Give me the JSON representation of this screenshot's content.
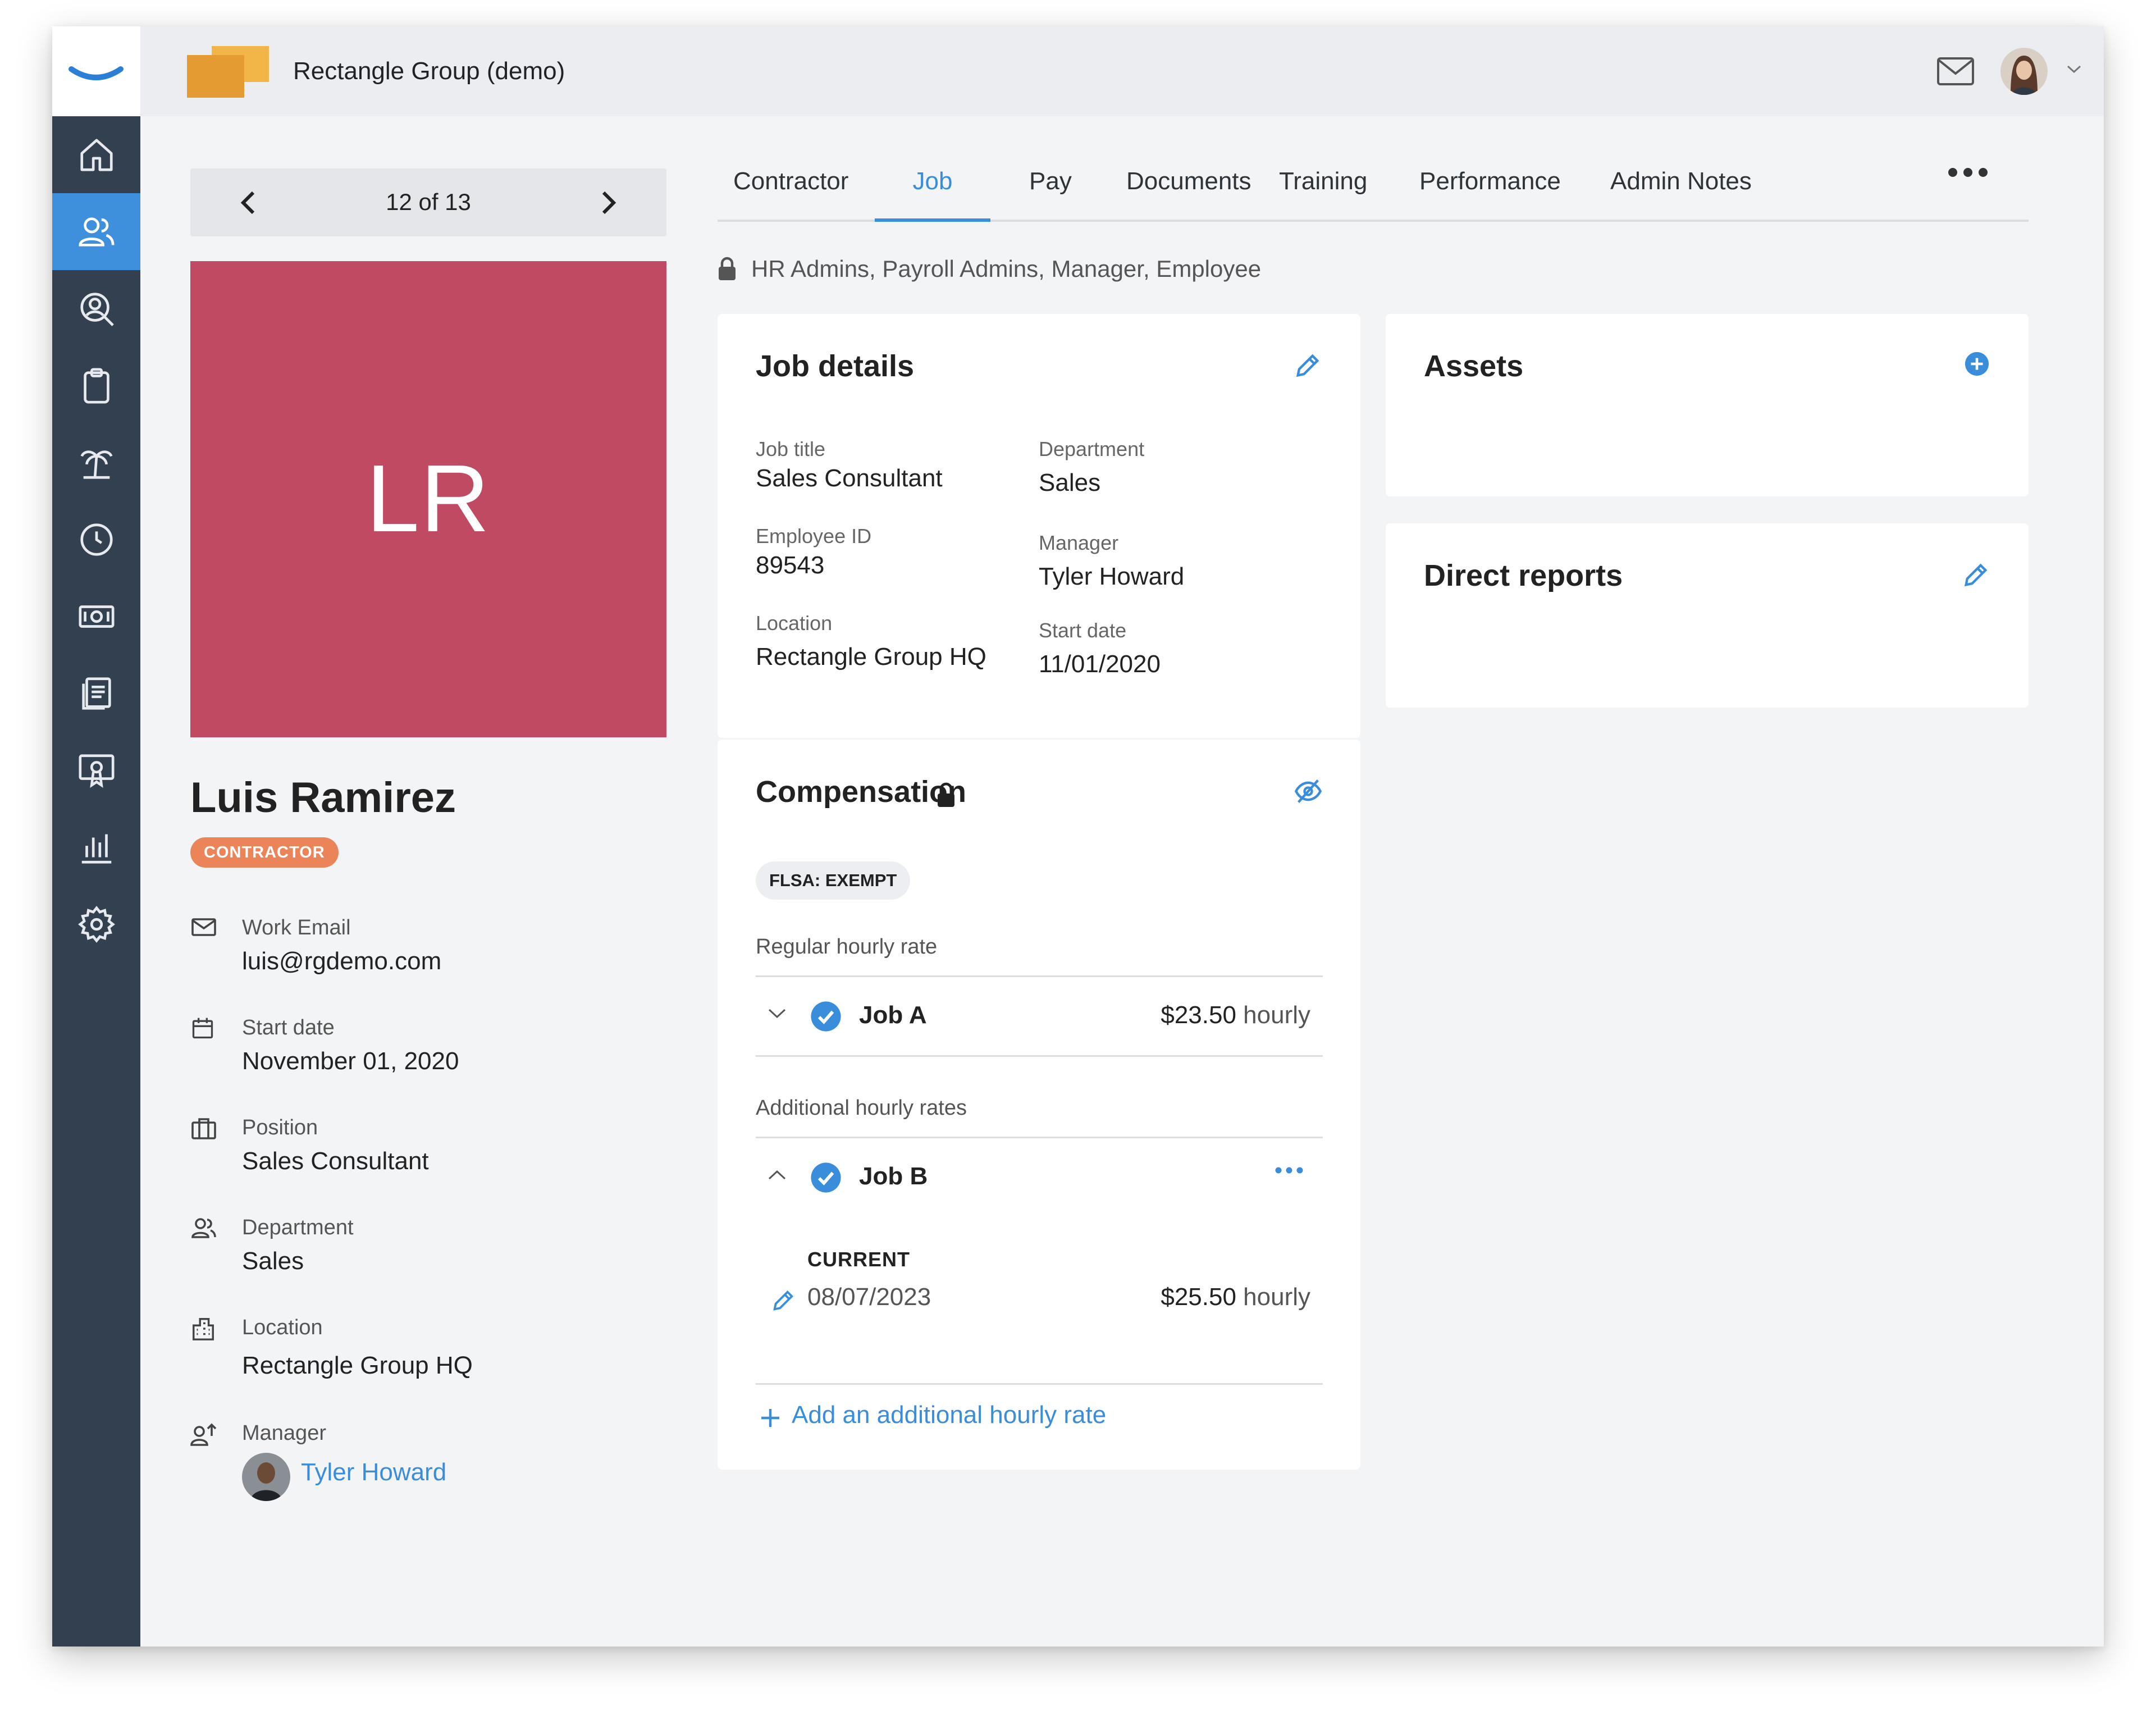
{
  "app": {
    "org_name": "Rectangle Group (demo)"
  },
  "rail": {
    "items": [
      {
        "icon": "home-icon"
      },
      {
        "icon": "people-icon",
        "active": true
      },
      {
        "icon": "user-search-icon"
      },
      {
        "icon": "clipboard-icon"
      },
      {
        "icon": "palm-tree-icon"
      },
      {
        "icon": "clock-icon"
      },
      {
        "icon": "money-icon"
      },
      {
        "icon": "documents-icon"
      },
      {
        "icon": "certificate-icon"
      },
      {
        "icon": "bar-chart-icon"
      },
      {
        "icon": "gear-icon"
      }
    ]
  },
  "pager": {
    "label": "12 of 13"
  },
  "profile": {
    "initials": "LR",
    "name": "Luis Ramirez",
    "badge": "CONTRACTOR",
    "fields": [
      {
        "icon": "mail-icon",
        "label": "Work Email",
        "value": "luis@rgdemo.com"
      },
      {
        "icon": "calendar-icon",
        "label": "Start date",
        "value": "November 01, 2020"
      },
      {
        "icon": "briefcase-icon",
        "label": "Position",
        "value": "Sales Consultant"
      },
      {
        "icon": "people-icon",
        "label": "Department",
        "value": "Sales"
      },
      {
        "icon": "building-icon",
        "label": "Location",
        "value": "Rectangle Group HQ"
      },
      {
        "icon": "manager-icon",
        "label": "Manager",
        "value": "Tyler Howard"
      }
    ]
  },
  "tabs": [
    "Contractor",
    "Job",
    "Pay",
    "Documents",
    "Training",
    "Performance",
    "Admin Notes"
  ],
  "active_tab": "Job",
  "access": {
    "text": "HR Admins, Payroll Admins, Manager, Employee"
  },
  "job_details": {
    "title": "Job details",
    "left": [
      {
        "label": "Job title",
        "value": "Sales Consultant"
      },
      {
        "label": "Employee ID",
        "value": "89543"
      },
      {
        "label": "Location",
        "value": "Rectangle Group HQ"
      }
    ],
    "right": [
      {
        "label": "Department",
        "value": "Sales"
      },
      {
        "label": "Manager",
        "value": "Tyler Howard"
      },
      {
        "label": "Start date",
        "value": "11/01/2020"
      }
    ]
  },
  "assets": {
    "title": "Assets"
  },
  "direct_reports": {
    "title": "Direct reports"
  },
  "compensation": {
    "title": "Compensation",
    "flsa": "FLSA: EXEMPT",
    "regular_label": "Regular hourly rate",
    "regular": {
      "job": "Job A",
      "amount": "$23.50",
      "unit": "hourly"
    },
    "additional_label": "Additional hourly rates",
    "additional": {
      "job": "Job B",
      "status": "CURRENT",
      "date": "08/07/2023",
      "amount": "$25.50",
      "unit": "hourly"
    },
    "add_link": "Add an additional hourly rate"
  },
  "colors": {
    "accent": "#3a8ddb",
    "rail": "#33404f",
    "avatar_bg": "#c04a62",
    "badge": "#ec845a"
  }
}
